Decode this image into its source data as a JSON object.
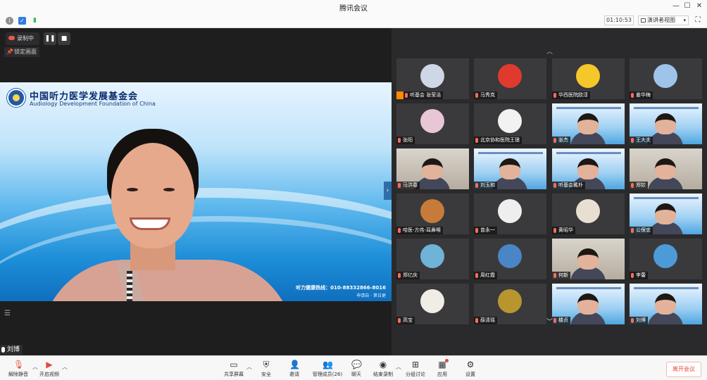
{
  "window": {
    "title": "腾讯会议",
    "timer": "01:10:53",
    "view_mode": "演讲者视图",
    "controls": [
      "minimize",
      "maximize",
      "close"
    ]
  },
  "recording": {
    "label": "录制中",
    "pause_icon": "pause-icon",
    "stop_icon": "stop-icon",
    "lock_view_label": "锁定画面"
  },
  "main_video": {
    "org_name_cn": "中国听力医学发展基金会",
    "org_name_en": "Audiology Development Foundation of China",
    "hotline": "听力健康热线：010-88332866-8016",
    "footer_small": "申请自 · 第日更",
    "speaker_name": "刘博"
  },
  "gallery": {
    "tiles": [
      {
        "name": "听基会 张莹洁",
        "kind": "avatar",
        "color": "#cfd6e6"
      },
      {
        "name": "马秀岚",
        "kind": "avatar",
        "color": "#e03a2e"
      },
      {
        "name": "华西医院欧淳",
        "kind": "avatar",
        "color": "#f4c82a"
      },
      {
        "name": "姜华梅",
        "kind": "avatar",
        "color": "#9ec4ea"
      },
      {
        "name": "张阳",
        "kind": "avatar",
        "color": "#e9c6d6"
      },
      {
        "name": "北京协和医院王璟",
        "kind": "avatar",
        "color": "#f2f2f2"
      },
      {
        "name": "张杰",
        "kind": "video-slide"
      },
      {
        "name": "王大夫",
        "kind": "video-slide"
      },
      {
        "name": "马洪春",
        "kind": "video-room"
      },
      {
        "name": "刘玉和",
        "kind": "video-slide"
      },
      {
        "name": "听基会戴朴",
        "kind": "video-slide"
      },
      {
        "name": "郑钦",
        "kind": "video-room"
      },
      {
        "name": "哈医-方伟-耳鼻喉",
        "kind": "avatar",
        "color": "#c77b3a"
      },
      {
        "name": "曾永一",
        "kind": "avatar",
        "color": "#eeeeee"
      },
      {
        "name": "黄昭华",
        "kind": "avatar",
        "color": "#e7e0d2"
      },
      {
        "name": "公保忠",
        "kind": "video-slide"
      },
      {
        "name": "郑亿庆",
        "kind": "avatar",
        "color": "#6fb3d8"
      },
      {
        "name": "周红霞",
        "kind": "avatar",
        "color": "#4a86c6"
      },
      {
        "name": "何新",
        "kind": "video-room"
      },
      {
        "name": "李蕾",
        "kind": "avatar",
        "color": "#4d9ad8"
      },
      {
        "name": "高宝",
        "kind": "avatar",
        "color": "#f0ede6"
      },
      {
        "name": "薛清瑶",
        "kind": "avatar",
        "color": "#b9952f"
      },
      {
        "name": "楼贞",
        "kind": "video-slide"
      },
      {
        "name": "刘博",
        "kind": "video-slide"
      }
    ]
  },
  "toolbar": {
    "unmute": "解除静音",
    "video": "开启视频",
    "share": "共享屏幕",
    "security": "安全",
    "invite": "邀请",
    "participants": "管理成员(26)",
    "chat": "聊天",
    "record": "结束录制",
    "breakout": "分组讨论",
    "apps": "应用",
    "settings": "设置",
    "leave": "离开会议"
  }
}
